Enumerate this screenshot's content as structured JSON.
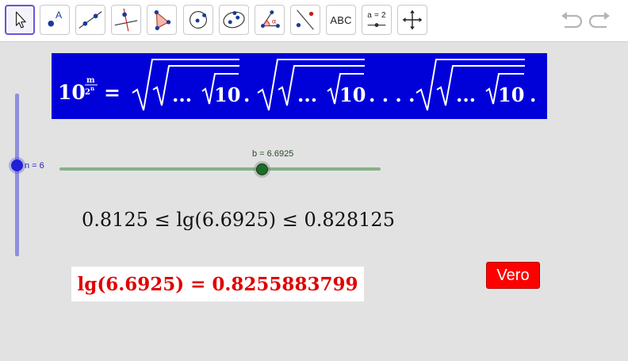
{
  "toolbar": {
    "tools": [
      {
        "name": "move-tool",
        "icon": "arrow-pointer-icon"
      },
      {
        "name": "point-tool",
        "icon": "point-icon",
        "glyph": "A"
      },
      {
        "name": "line-tool",
        "icon": "line-through-points-icon"
      },
      {
        "name": "perpendicular-line-tool",
        "icon": "perpendicular-icon"
      },
      {
        "name": "polygon-tool",
        "icon": "polygon-icon"
      },
      {
        "name": "circle-tool",
        "icon": "circle-center-point-icon"
      },
      {
        "name": "ellipse-tool",
        "icon": "ellipse-icon"
      },
      {
        "name": "angle-tool",
        "icon": "angle-icon",
        "glyph": "α"
      },
      {
        "name": "reflect-tool",
        "icon": "reflect-about-line-icon"
      },
      {
        "name": "text-tool",
        "label": "ABC"
      },
      {
        "name": "slider-tool",
        "label": "a = 2"
      },
      {
        "name": "move-graphics-tool",
        "icon": "move-arrows-icon"
      }
    ],
    "undo_icon": "undo-icon",
    "redo_icon": "redo-icon"
  },
  "formula": {
    "base": "10",
    "exp_num": "m",
    "exp_den_base": "2",
    "exp_den_exp": "n",
    "equals": "=",
    "radicand_dots": "...",
    "radicand_value": "10",
    "separator": ".",
    "middle_dots": ". . . .",
    "colors": {
      "background": "#0000d9",
      "text": "#ffffff"
    }
  },
  "n_slider": {
    "label": "n = 6",
    "value": 6,
    "color": "#1f1fd6"
  },
  "b_slider": {
    "label": "b = 6.6925",
    "value": 6.6925,
    "color": "#1f6b2a"
  },
  "inequality": {
    "text": "0.8125 ≤ lg(6.6925) ≤ 0.828125"
  },
  "result": {
    "text": "lg(6.6925) = 0.8255883799",
    "color": "#e00000"
  },
  "verdict_button": {
    "label": "Vero",
    "color": "#ff0000"
  }
}
